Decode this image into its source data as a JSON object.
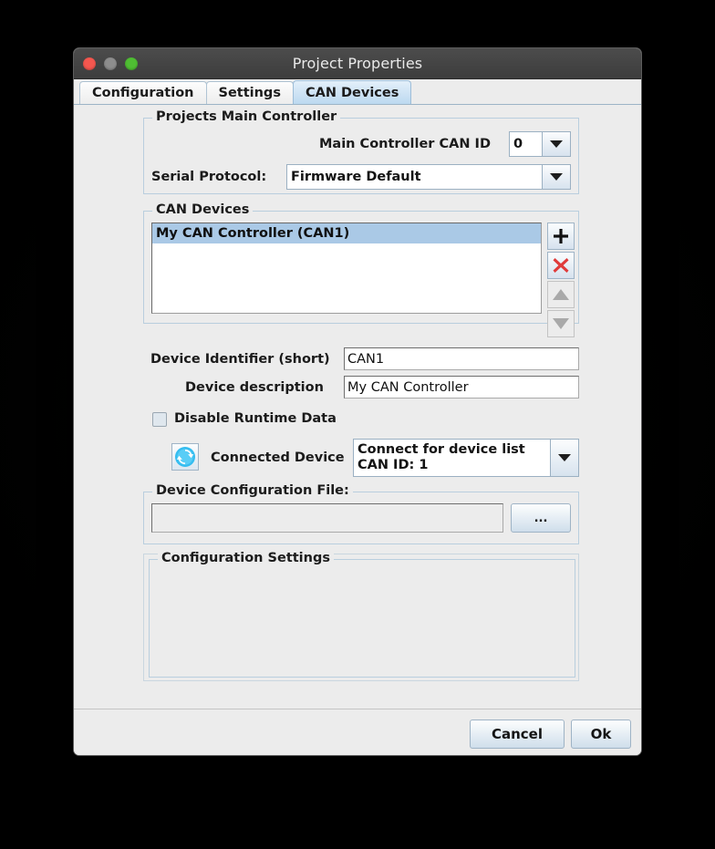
{
  "window": {
    "title": "Project Properties",
    "traffic_lights": [
      "close-red",
      "minimize-gray",
      "zoom-green"
    ]
  },
  "tabs": [
    {
      "label": "Configuration",
      "active": false
    },
    {
      "label": "Settings",
      "active": false
    },
    {
      "label": "CAN Devices",
      "active": true
    }
  ],
  "main_controller": {
    "legend": "Projects Main Controller",
    "can_id_label": "Main Controller CAN ID",
    "can_id_value": "0",
    "serial_protocol_label": "Serial Protocol:",
    "serial_protocol_value": "Firmware Default"
  },
  "can_devices": {
    "legend": "CAN Devices",
    "items": [
      {
        "label": "My CAN Controller (CAN1)",
        "selected": true
      }
    ],
    "buttons": {
      "add": "+",
      "remove": "X",
      "move_up": "up-triangle",
      "move_down": "down-triangle"
    }
  },
  "device_fields": {
    "identifier_label": "Device Identifier (short)",
    "identifier_value": "CAN1",
    "description_label": "Device description",
    "description_value": "My CAN Controller",
    "disable_runtime_label": "Disable Runtime Data",
    "disable_runtime_checked": false,
    "connected_device_label": "Connected Device",
    "connected_device_line1": "Connect for device list",
    "connected_device_line2": "CAN ID: 1",
    "refresh_icon": "refresh-icon"
  },
  "config_file": {
    "legend": "Device Configuration File:",
    "path_value": "",
    "browse_label": "..."
  },
  "config_settings": {
    "legend": "Configuration Settings"
  },
  "footer": {
    "cancel_label": "Cancel",
    "ok_label": "Ok"
  },
  "colors": {
    "accent_selection": "#aac9e6",
    "tab_active": "#bcd9f0",
    "group_border": "#b9cede",
    "remove_red": "#e03b3b",
    "refresh_blue": "#29abe2"
  }
}
